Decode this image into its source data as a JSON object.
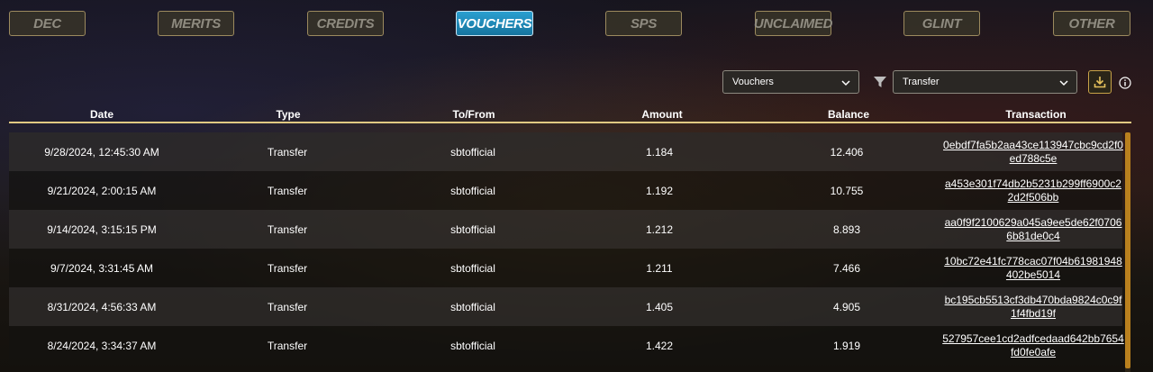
{
  "tabs": [
    {
      "label": "DEC"
    },
    {
      "label": "MERITS"
    },
    {
      "label": "CREDITS"
    },
    {
      "label": "VOUCHERS",
      "active": true
    },
    {
      "label": "SPS"
    },
    {
      "label": "UNCLAIMED"
    },
    {
      "label": "GLINT"
    },
    {
      "label": "OTHER"
    }
  ],
  "filters": {
    "token_select": "Vouchers",
    "type_select": "Transfer",
    "filter_icon": "funnel-icon",
    "download_icon": "download-icon",
    "info_icon": "info-icon"
  },
  "table": {
    "headers": [
      "Date",
      "Type",
      "To/From",
      "Amount",
      "Balance",
      "Transaction"
    ],
    "rows": [
      {
        "date": "9/28/2024, 12:45:30 AM",
        "type": "Transfer",
        "to_from": "sbtofficial",
        "amount": "1.184",
        "balance": "12.406",
        "transaction": "0ebdf7fa5b2aa43ce113947cbc9cd2f0ed788c5e"
      },
      {
        "date": "9/21/2024, 2:00:15 AM",
        "type": "Transfer",
        "to_from": "sbtofficial",
        "amount": "1.192",
        "balance": "10.755",
        "transaction": "a453e301f74db2b5231b299ff6900c22d2f506bb"
      },
      {
        "date": "9/14/2024, 3:15:15 PM",
        "type": "Transfer",
        "to_from": "sbtofficial",
        "amount": "1.212",
        "balance": "8.893",
        "transaction": "aa0f9f2100629a045a9ee5de62f07066b81de0c4"
      },
      {
        "date": "9/7/2024, 3:31:45 AM",
        "type": "Transfer",
        "to_from": "sbtofficial",
        "amount": "1.211",
        "balance": "7.466",
        "transaction": "10bc72e41fc778cac07f04b61981948402be5014"
      },
      {
        "date": "8/31/2024, 4:56:33 AM",
        "type": "Transfer",
        "to_from": "sbtofficial",
        "amount": "1.405",
        "balance": "4.905",
        "transaction": "bc195cb5513cf3db470bda9824c0c9f1f4fbd19f"
      },
      {
        "date": "8/24/2024, 3:34:37 AM",
        "type": "Transfer",
        "to_from": "sbtofficial",
        "amount": "1.422",
        "balance": "1.919",
        "transaction": "527957cee1cd2adfcedaad642bb7654fd0fe0afe"
      }
    ]
  },
  "colors": {
    "accent_gold": "#e0c982",
    "active_tab": "#1f8bbd",
    "scrollbar": "#b9801e"
  }
}
